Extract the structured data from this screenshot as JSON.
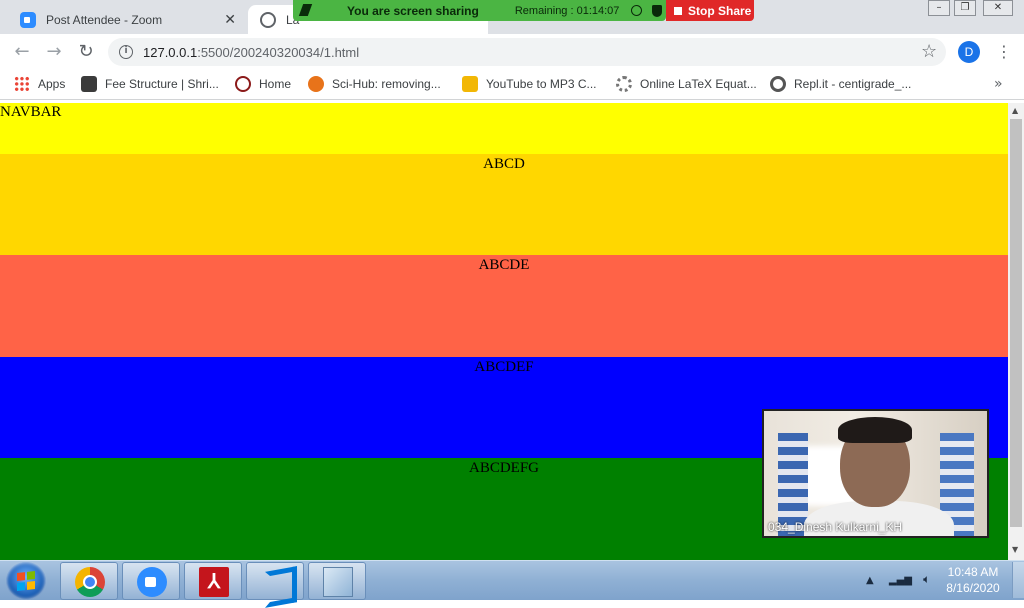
{
  "browser": {
    "tabs": [
      {
        "title": "Post Attendee - Zoom",
        "icon": "zoom-icon"
      },
      {
        "title": "La",
        "icon": "globe-icon",
        "active": true
      }
    ],
    "url_host": "127.0.0.1",
    "url_path": ":5500/200240320034/1.html",
    "profile_initial": "D",
    "bookmarks": [
      {
        "label": "Apps",
        "icon": "apps-grid-icon"
      },
      {
        "label": "Fee Structure | Shri...",
        "icon": "site-icon"
      },
      {
        "label": "Home",
        "icon": "site-icon"
      },
      {
        "label": "Sci-Hub: removing...",
        "icon": "scihub-icon"
      },
      {
        "label": "YouTube to MP3 C...",
        "icon": "site-icon"
      },
      {
        "label": "Online LaTeX Equat...",
        "icon": "gear-icon"
      },
      {
        "label": "Repl.it - centigrade_...",
        "icon": "replit-icon"
      }
    ]
  },
  "screen_share": {
    "status": "You are screen sharing",
    "remaining": "Remaining : 01:14:07",
    "stop_label": "Stop Share"
  },
  "page": {
    "navbar": "NAVBAR",
    "sections": [
      "ABCD",
      "ABCDE",
      "ABCDEF",
      "ABCDEFG"
    ],
    "colors": {
      "navbar": "#ffff00",
      "section1": "#ffd700",
      "section2": "#ff6347",
      "section3": "#0000ff",
      "section4": "#008000"
    }
  },
  "video": {
    "participant": "034_Dinesh Kulkarni_KH"
  },
  "taskbar": {
    "apps": [
      "chrome",
      "zoom",
      "acrobat",
      "vscode",
      "notepad"
    ],
    "time": "10:48 AM",
    "date": "8/16/2020"
  }
}
